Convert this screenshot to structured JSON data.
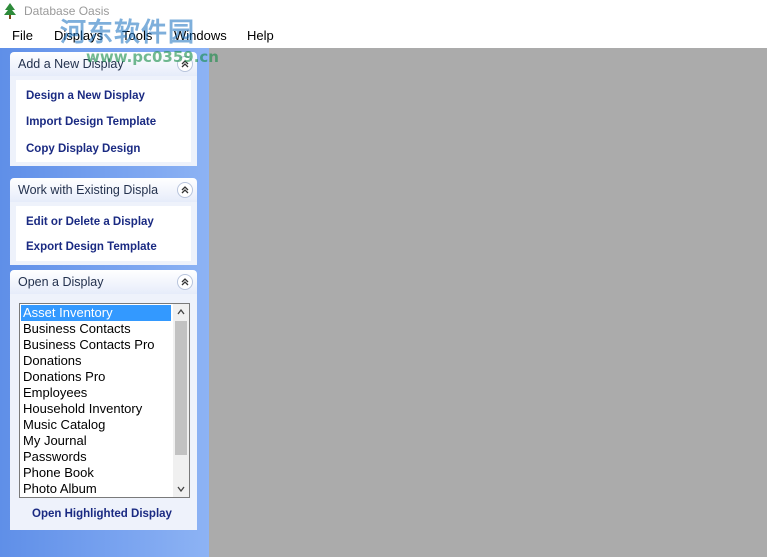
{
  "app": {
    "title": "Database Oasis"
  },
  "watermark": {
    "text": "河东软件园",
    "url": "www.pc0359.cn"
  },
  "menu": [
    "File",
    "Displays",
    "Tools",
    "Windows",
    "Help"
  ],
  "panels": {
    "add": {
      "title": "Add a New Display",
      "links": [
        "Design a New Display",
        "Import Design Template",
        "Copy Display Design"
      ]
    },
    "work": {
      "title": "Work with Existing Displa",
      "links": [
        "Edit or Delete a Display",
        "Export Design Template"
      ]
    },
    "open": {
      "title": "Open a Display",
      "list": [
        "Asset Inventory",
        "Business Contacts",
        "Business Contacts Pro",
        "Donations",
        "Donations Pro",
        "Employees",
        "Household Inventory",
        "Music Catalog",
        "My Journal",
        "Passwords",
        "Phone Book",
        "Photo Album"
      ],
      "selected": "Asset Inventory",
      "open_button": "Open Highlighted Display"
    }
  },
  "colors": {
    "sidebar": "#6f9cee",
    "mdi_background": "#ababab",
    "selection": "#3399ff",
    "link": "#1a2a82"
  },
  "icons": {
    "app": "tree-icon",
    "collapse": "chevron-double-up-icon"
  }
}
